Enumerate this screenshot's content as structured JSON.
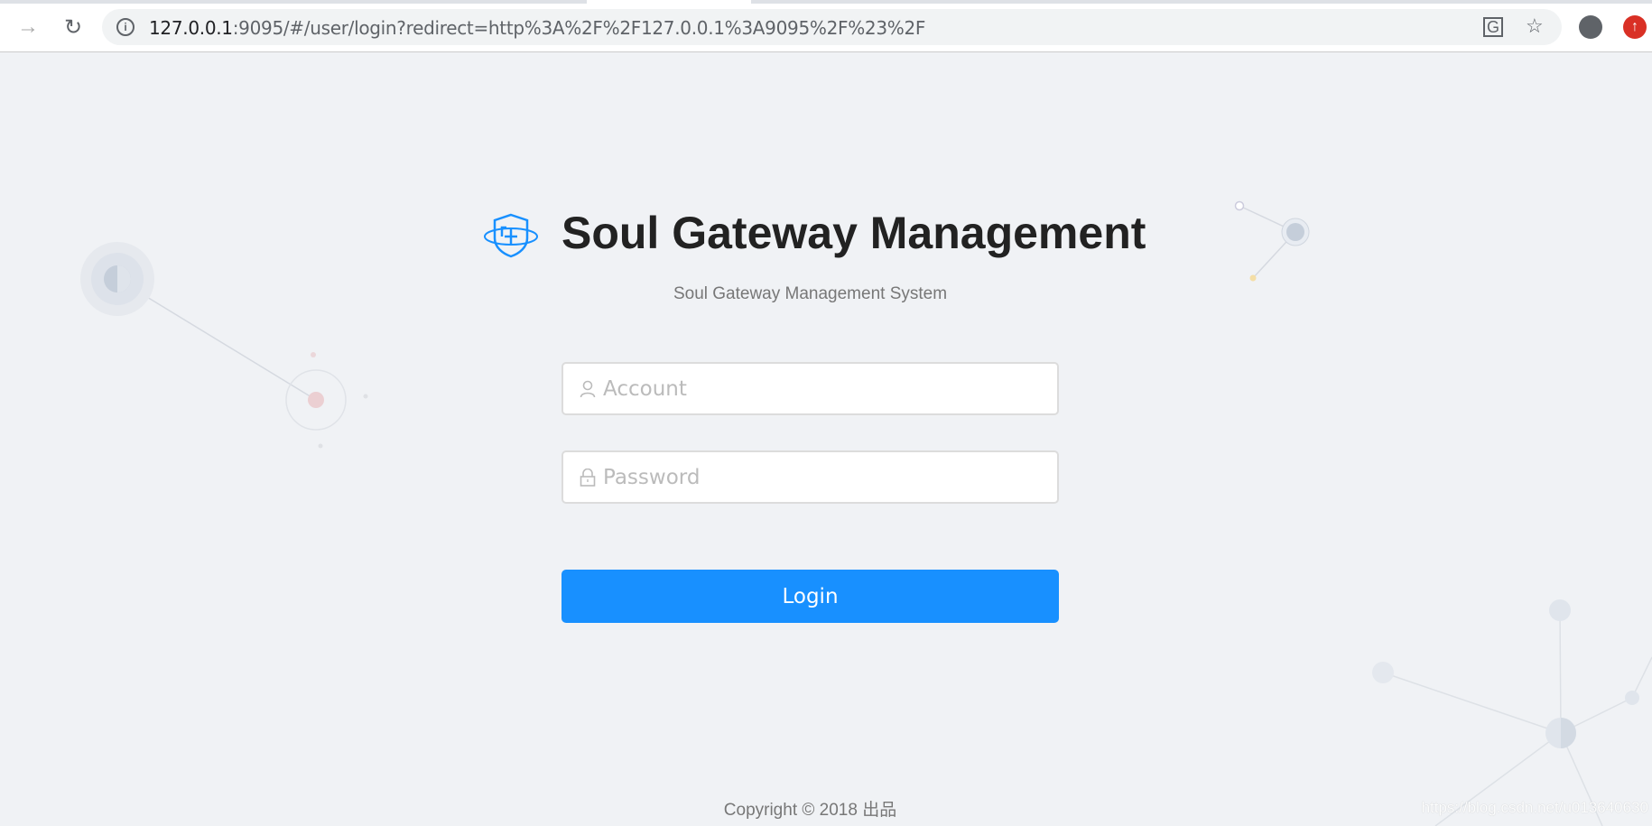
{
  "browser": {
    "url_host": "127.0.0.1",
    "url_rest": ":9095/#/user/login?redirect=http%3A%2F%2F127.0.0.1%3A9095%2F%23%2F",
    "icons": [
      "forward-icon",
      "reload-icon",
      "info-icon",
      "translate-icon",
      "star-icon",
      "profile-icon",
      "extension-icon"
    ]
  },
  "header": {
    "title": "Soul Gateway Management",
    "subtitle": "Soul Gateway Management System",
    "logo_color": "#1890ff"
  },
  "form": {
    "account_placeholder": "Account",
    "password_placeholder": "Password",
    "login_label": "Login",
    "accent": "#1890ff"
  },
  "footer": {
    "copyright": "Copyright © 2018 出品",
    "watermark": "https://blog.csdn.net/u013640630"
  }
}
